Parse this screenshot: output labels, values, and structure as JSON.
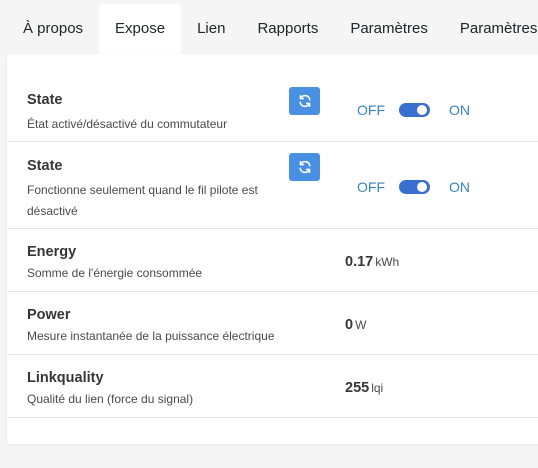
{
  "tabs": [
    {
      "label": "À propos"
    },
    {
      "label": "Expose"
    },
    {
      "label": "Lien"
    },
    {
      "label": "Rapports"
    },
    {
      "label": "Paramètres"
    },
    {
      "label": "Paramètres"
    }
  ],
  "active_tab": "Expose",
  "rows": [
    {
      "name": "State",
      "desc": "État activé/désactivé du commutateur",
      "off_label": "OFF",
      "on_label": "ON",
      "state": "ON"
    },
    {
      "name": "State",
      "desc_line1": "Fonctionne seulement quand le fil pilote est",
      "desc_line2": "désactivé",
      "off_label": "OFF",
      "on_label": "ON",
      "state": "ON"
    },
    {
      "name": "Energy",
      "desc": "Somme de l'énergie consommée",
      "value": "0.17",
      "unit": "kWh"
    },
    {
      "name": "Power",
      "desc": "Mesure instantanée de la puissance électrique",
      "value": "0",
      "unit": "W"
    },
    {
      "name": "Linkquality",
      "desc": "Qualité du lien (force du signal)",
      "value": "255",
      "unit": "lqi"
    }
  ],
  "icons": {
    "refresh": "refresh-icon"
  },
  "colors": {
    "accent": "#4a90e2",
    "toggle": "#3b6fcf",
    "toggle_label": "#3b82c4"
  }
}
